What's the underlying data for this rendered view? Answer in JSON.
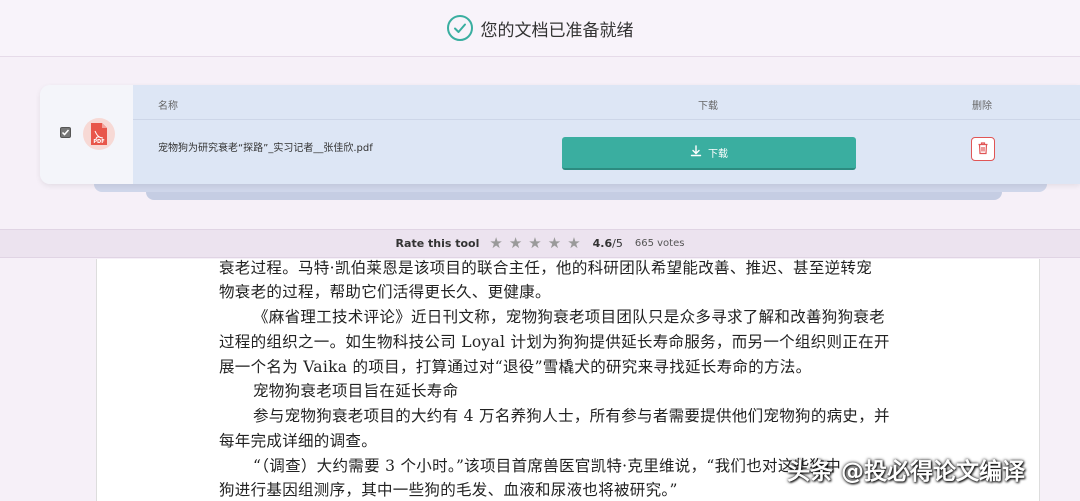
{
  "status": {
    "text": "您的文档已准备就绪",
    "icon": "check-circle-icon"
  },
  "table": {
    "headers": {
      "name": "名称",
      "download": "下载",
      "delete": "删除"
    },
    "file": {
      "name": "宠物狗为研究衰老“探路”_实习记者__张佳欣.pdf",
      "icon": "pdf-file-icon",
      "icon_label": "PDF"
    },
    "download_button": "下载",
    "delete_icon": "trash-icon"
  },
  "rating": {
    "label": "Rate this tool",
    "score": "4.6",
    "max": "/5",
    "votes": "665 votes",
    "stars": 5
  },
  "document": {
    "lines": [
      "衰老过程。马特·凯伯莱恩是该项目的联合主任，他的科研团队希望能改善、推迟、甚至逆转宠",
      "物衰老的过程，帮助它们活得更长久、更健康。",
      "《麻省理工技术评论》近日刊文称，宠物狗衰老项目团队只是众多寻求了解和改善狗狗衰老",
      "过程的组织之一。如生物科技公司 Loyal 计划为狗狗提供延长寿命服务，而另一个组织则正在开",
      "展一个名为 Vaika 的项目，打算通过对“退役”雪橇犬的研究来寻找延长寿命的方法。",
      "宠物狗衰老项目旨在延长寿命",
      "参与宠物狗衰老项目的大约有 4 万名养狗人士，所有参与者需要提供他们宠物狗的病史，并",
      "每年完成详细的调查。",
      "“（调查）大约需要 3 个小时。”该项目首席兽医官凯特·克里维说，“我们也对这些狗中",
      "狗进行基因组测序，其中一些狗的毛发、血液和尿液也将被研究。”"
    ]
  },
  "watermark": "头条 @投必得论文编译",
  "colors": {
    "accent": "#3aaea0",
    "danger": "#e05555"
  }
}
